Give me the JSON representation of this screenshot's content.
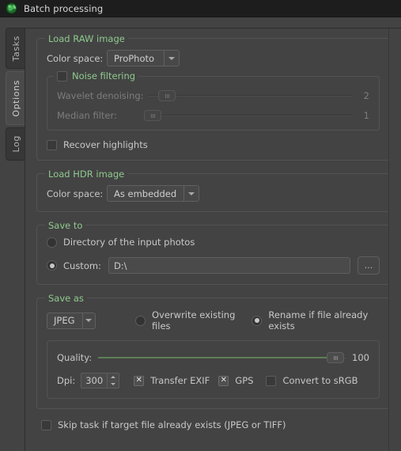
{
  "window": {
    "title": "Batch processing",
    "icon": "app-globe-icon"
  },
  "tabs": [
    {
      "label": "Tasks",
      "selected": false
    },
    {
      "label": "Options",
      "selected": true
    },
    {
      "label": "Log",
      "selected": false
    }
  ],
  "load_raw": {
    "title": "Load RAW image",
    "color_space_label": "Color space:",
    "color_space_value": "ProPhoto",
    "noise_filtering": {
      "title": "Noise filtering",
      "checked": false,
      "wavelet_label": "Wavelet denoising:",
      "wavelet_value": "2",
      "median_label": "Median filter:",
      "median_value": "1"
    },
    "recover_highlights_label": "Recover highlights",
    "recover_highlights_checked": false
  },
  "load_hdr": {
    "title": "Load HDR image",
    "color_space_label": "Color space:",
    "color_space_value": "As embedded"
  },
  "save_to": {
    "title": "Save to",
    "option_input_dir": "Directory of the input photos",
    "option_custom": "Custom:",
    "custom_path": "D:\\",
    "browse_label": "...",
    "selected": "custom"
  },
  "save_as": {
    "title": "Save as",
    "format_value": "JPEG",
    "option_overwrite": "Overwrite existing files",
    "option_rename": "Rename if file already exists",
    "selected": "rename",
    "quality_label": "Quality:",
    "quality_value": "100",
    "dpi_label": "Dpi:",
    "dpi_value": "300",
    "transfer_exif_label": "Transfer EXIF",
    "transfer_exif_checked": true,
    "gps_label": "GPS",
    "gps_checked": true,
    "convert_srgb_label": "Convert to sRGB",
    "convert_srgb_checked": false
  },
  "footer": {
    "skip_task_label": "Skip task if target file already exists (JPEG or TIFF)",
    "skip_task_checked": false
  },
  "colors": {
    "group_title": "#8fc98f",
    "titlebar_bg": "#1d1d1d",
    "panel_bg": "#434343",
    "slider_fill": "#5f7f56",
    "text": "#c8c8c8",
    "text_disabled": "#7d7d7d"
  }
}
